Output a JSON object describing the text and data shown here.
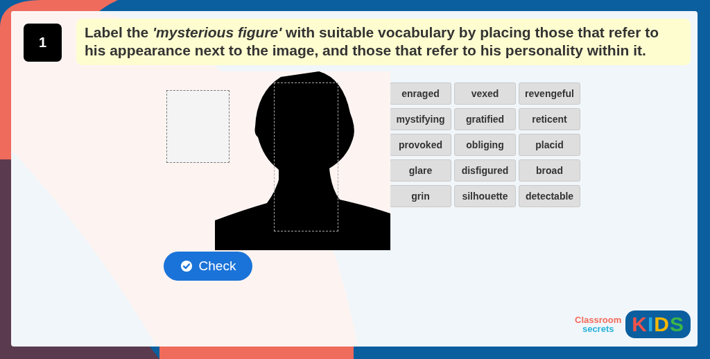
{
  "question": {
    "number": "1",
    "text": "Label the *'mysterious figure'* with suitable vocabulary by placing those that refer to his appearance next to the image, and those that refer to his personality within it."
  },
  "word_tiles": [
    "enraged",
    "vexed",
    "revengeful",
    "mystifying",
    "gratified",
    "reticent",
    "provoked",
    "obliging",
    "placid",
    "glare",
    "disfigured",
    "broad",
    "grin",
    "silhouette",
    "detectable"
  ],
  "check_button": {
    "label": "Check"
  },
  "logo": {
    "brand_top": "Classroom",
    "brand_bottom": "secrets",
    "badge": "KIDS"
  }
}
